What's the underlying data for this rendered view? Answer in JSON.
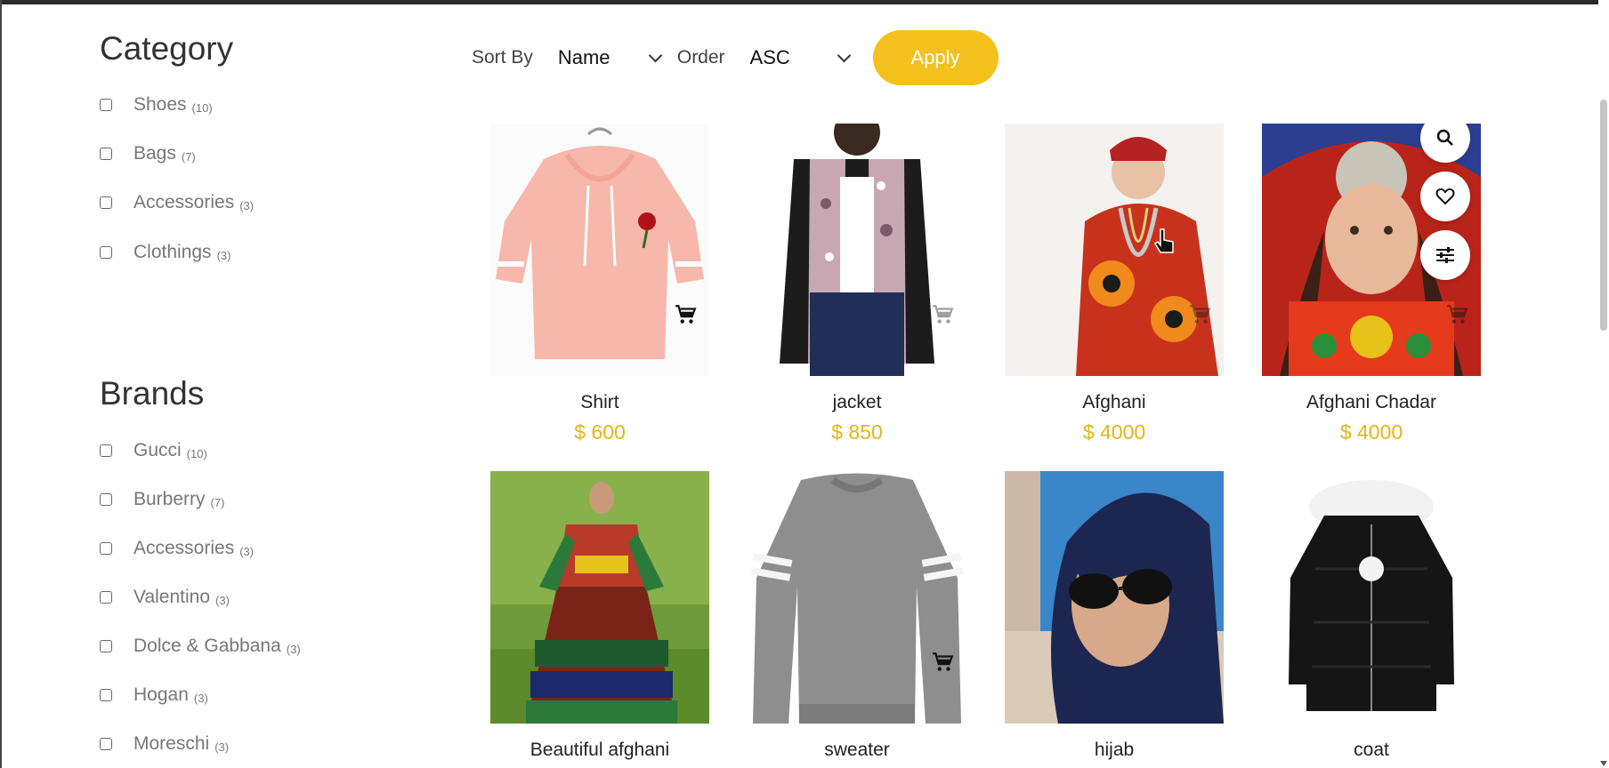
{
  "sidebar": {
    "category_title": "Category",
    "categories": [
      {
        "label": "Shoes",
        "count": "(10)"
      },
      {
        "label": "Bags",
        "count": "(7)"
      },
      {
        "label": "Accessories",
        "count": "(3)"
      },
      {
        "label": "Clothings",
        "count": "(3)"
      }
    ],
    "brands_title": "Brands",
    "brands": [
      {
        "label": "Gucci",
        "count": "(10)"
      },
      {
        "label": "Burberry",
        "count": "(7)"
      },
      {
        "label": "Accessories",
        "count": "(3)"
      },
      {
        "label": "Valentino",
        "count": "(3)"
      },
      {
        "label": "Dolce & Gabbana",
        "count": "(3)"
      },
      {
        "label": "Hogan",
        "count": "(3)"
      },
      {
        "label": "Moreschi",
        "count": "(3)"
      }
    ]
  },
  "toolbar": {
    "sort_by_label": "Sort By",
    "sort_value": "Name",
    "order_label": "Order",
    "order_value": "ASC",
    "apply_label": "Apply"
  },
  "products": [
    {
      "name": "Shirt",
      "price": "$ 600"
    },
    {
      "name": "jacket",
      "price": "$ 850"
    },
    {
      "name": "Afghani",
      "price": "$ 4000"
    },
    {
      "name": "Afghani Chadar",
      "price": "$ 4000"
    },
    {
      "name": "Beautiful afghani",
      "price": ""
    },
    {
      "name": "sweater",
      "price": ""
    },
    {
      "name": "hijab",
      "price": ""
    },
    {
      "name": "coat",
      "price": ""
    }
  ],
  "colors": {
    "accent": "#f4c01d",
    "price": "#e6b517"
  }
}
